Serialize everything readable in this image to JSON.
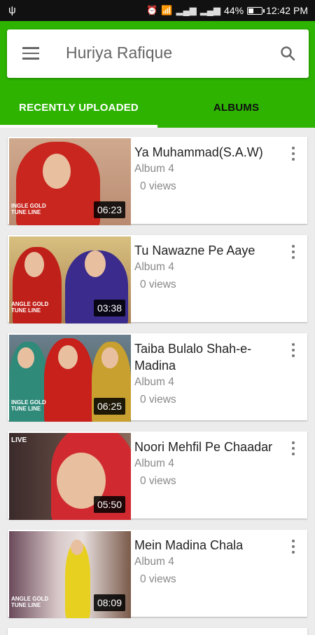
{
  "status_bar": {
    "usb_icon": "usb-icon",
    "battery_percent": "44%",
    "battery_level": 0.44,
    "time": "12:42 PM"
  },
  "app_bar": {
    "title": "Huriya Rafique",
    "menu_icon": "hamburger-menu-icon",
    "search_icon": "search-icon",
    "color": "#2db300"
  },
  "tabs": [
    {
      "label": "RECENTLY UPLOADED",
      "selected": true
    },
    {
      "label": "ALBUMS",
      "selected": false
    }
  ],
  "videos": [
    {
      "title": "Ya Muhammad(S.A.W)",
      "album": "Album 4",
      "views": "0 views",
      "duration": "06:23"
    },
    {
      "title": "Tu Nawazne Pe Aaye",
      "album": "Album 4",
      "views": "0 views",
      "duration": "03:38"
    },
    {
      "title": "Taiba Bulalo Shah-e-Madina",
      "album": "Album 4",
      "views": "0 views",
      "duration": "06:25"
    },
    {
      "title": "Noori Mehfil Pe Chaadar",
      "album": "Album 4",
      "views": "0 views",
      "duration": "05:50"
    },
    {
      "title": "Mein Madina Chala",
      "album": "Album 4",
      "views": "0 views",
      "duration": "08:09"
    }
  ]
}
